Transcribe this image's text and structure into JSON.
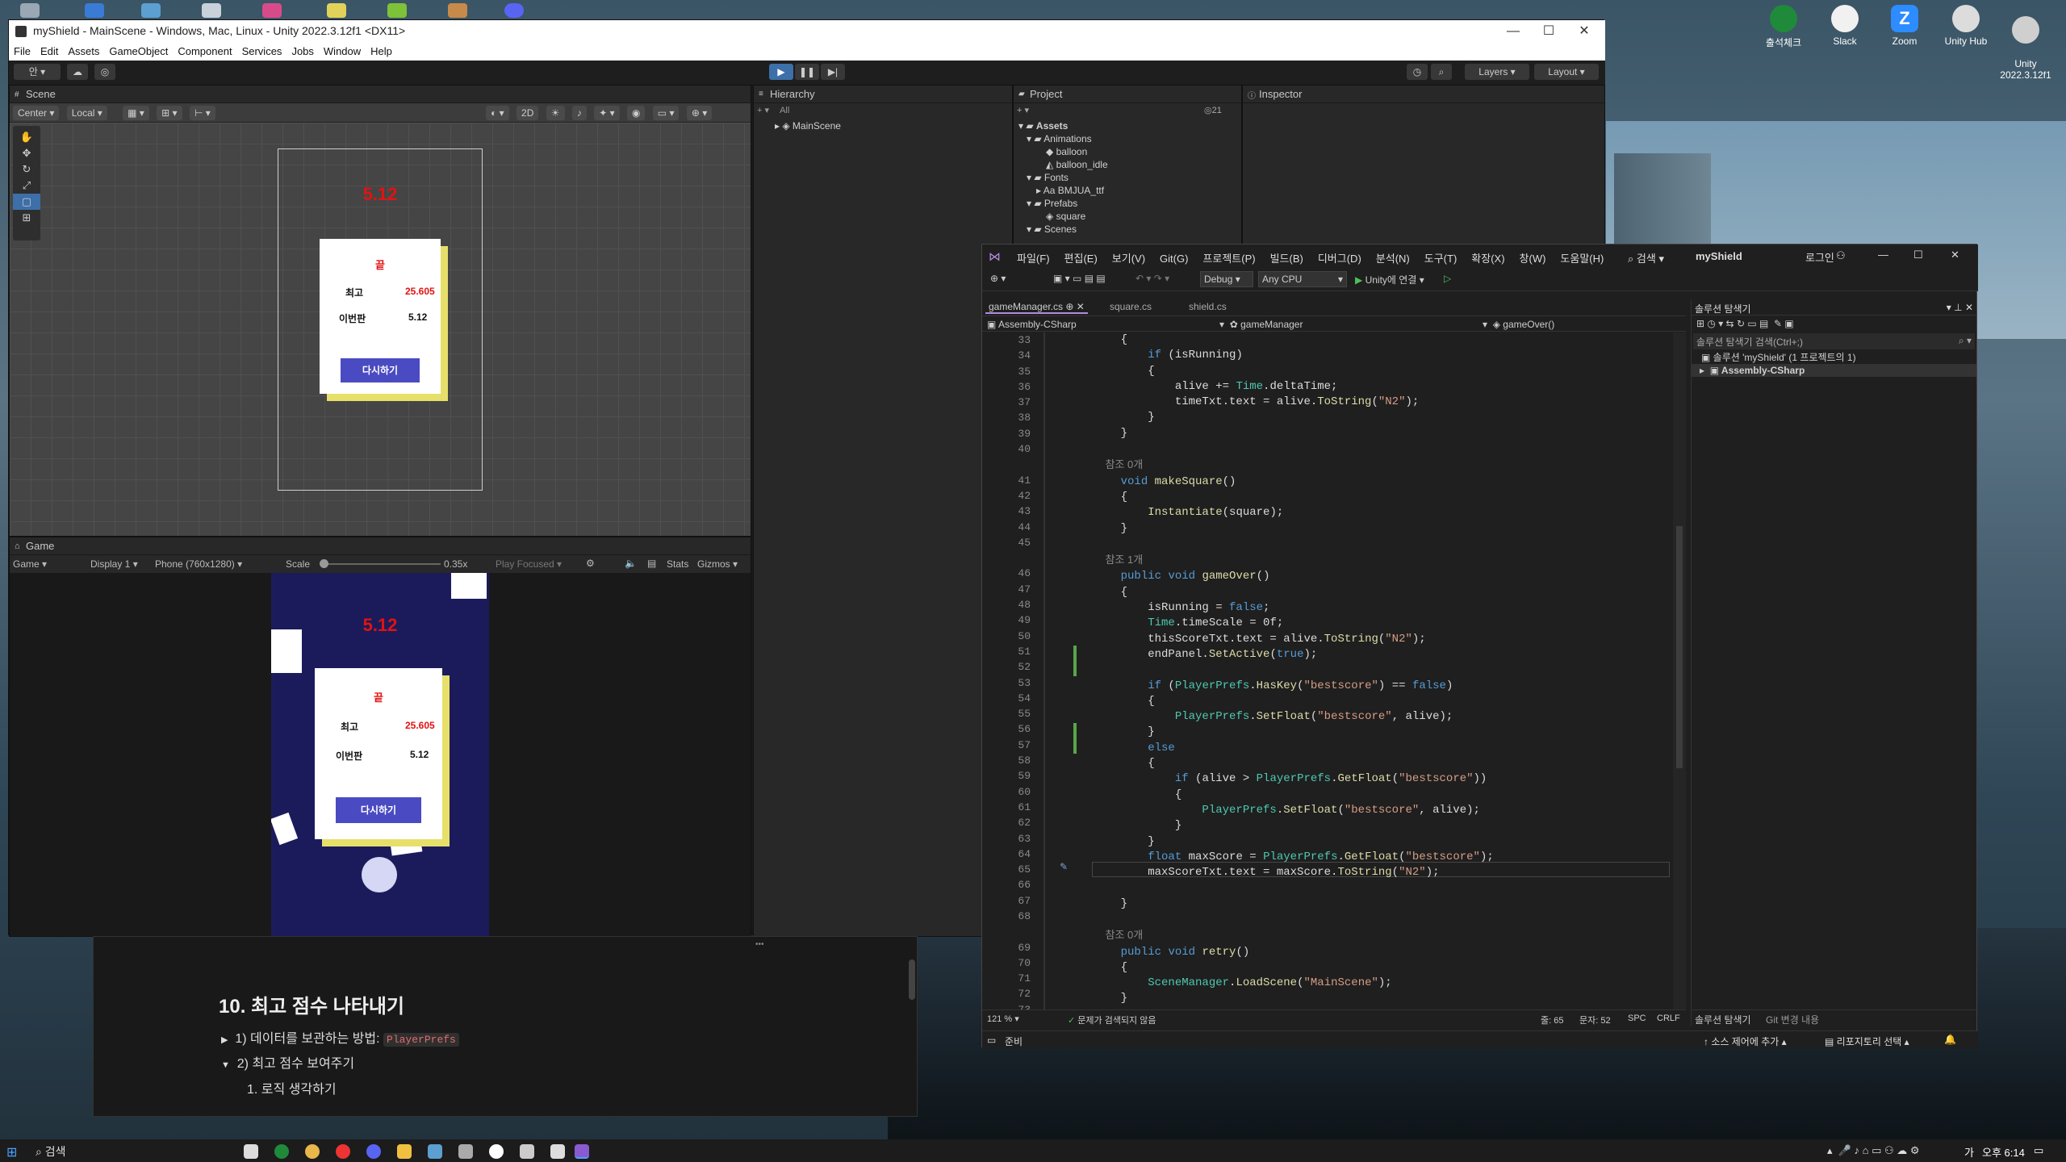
{
  "desktop": {
    "icons": [
      {
        "label": "출석체크",
        "color": "#1f8a3a"
      },
      {
        "label": "Slack",
        "color": "#e8e8e8"
      },
      {
        "label": "Zoom",
        "color": "#2d8cff"
      },
      {
        "label": "Unity Hub",
        "color": "#dddddd"
      },
      {
        "label": "Unity\n2022.3.12f1",
        "color": "#cccccc"
      }
    ]
  },
  "unity": {
    "title": "myShield - MainScene - Windows, Mac, Linux - Unity 2022.3.12f1 <DX11>",
    "menu": [
      "File",
      "Edit",
      "Assets",
      "GameObject",
      "Component",
      "Services",
      "Jobs",
      "Window",
      "Help"
    ],
    "toolbar": {
      "account": "안",
      "layers": "Layers",
      "layout": "Layout"
    },
    "scene": {
      "tab": "Scene",
      "pivot": "Center",
      "space": "Local",
      "mode2d": "2D",
      "score": "5.12",
      "card_title": "끝",
      "best_label": "최고",
      "best_value": "25.605",
      "this_label": "이번판",
      "this_value": "5.12",
      "retry": "다시하기"
    },
    "game": {
      "tab": "Game",
      "view": "Game",
      "display": "Display 1",
      "resolution": "Phone (760x1280)",
      "scale_label": "Scale",
      "scale_value": "0.35x",
      "play_mode": "Play Focused",
      "stats": "Stats",
      "gizmos": "Gizmos",
      "score": "5.12",
      "card_title": "끝",
      "best_label": "최고",
      "best_value": "25.605",
      "this_label": "이번판",
      "this_value": "5.12",
      "retry": "다시하기"
    },
    "hierarchy": {
      "tab": "Hierarchy",
      "search": "All",
      "root": "MainScene"
    },
    "project": {
      "tab": "Project",
      "count": "21",
      "items": [
        "Assets",
        "Animations",
        "balloon",
        "balloon_idle",
        "Fonts",
        "BMJUA_ttf",
        "Prefabs",
        "square",
        "Scenes"
      ]
    },
    "inspector": {
      "tab": "Inspector"
    }
  },
  "vs": {
    "menu": [
      "파일(F)",
      "편집(E)",
      "보기(V)",
      "Git(G)",
      "프로젝트(P)",
      "빌드(B)",
      "디버그(D)",
      "분석(N)",
      "도구(T)",
      "확장(X)",
      "창(W)",
      "도움말(H)"
    ],
    "search": "검색",
    "project_name": "myShield",
    "login": "로그인",
    "config": "Debug",
    "platform": "Any CPU",
    "attach": "Unity에 연결",
    "tabs": [
      "gameManager.cs",
      "square.cs",
      "shield.cs"
    ],
    "nav": {
      "project": "Assembly-CSharp",
      "class": "gameManager",
      "member": "gameOver()"
    },
    "line_numbers": [
      "33",
      "34",
      "35",
      "36",
      "37",
      "38",
      "39",
      "40",
      "",
      "41",
      "42",
      "43",
      "44",
      "45",
      "",
      "46",
      "47",
      "48",
      "49",
      "50",
      "51",
      "52",
      "53",
      "54",
      "55",
      "56",
      "57",
      "58",
      "59",
      "60",
      "61",
      "62",
      "63",
      "64",
      "65",
      "66",
      "67",
      "68",
      "",
      "69",
      "70",
      "71",
      "72",
      "73"
    ],
    "code": [
      "    {",
      "        if (isRunning)",
      "        {",
      "            alive += Time.deltaTime;",
      "            timeTxt.text = alive.ToString(\"N2\");",
      "        }",
      "    }",
      "",
      "    참조 0개",
      "    void makeSquare()",
      "    {",
      "        Instantiate(square);",
      "    }",
      "",
      "    참조 1개",
      "    public void gameOver()",
      "    {",
      "        isRunning = false;",
      "        Time.timeScale = 0f;",
      "        thisScoreTxt.text = alive.ToString(\"N2\");",
      "        endPanel.SetActive(true);",
      "",
      "        if (PlayerPrefs.HasKey(\"bestscore\") == false)",
      "        {",
      "            PlayerPrefs.SetFloat(\"bestscore\", alive);",
      "        }",
      "        else",
      "        {",
      "            if (alive > PlayerPrefs.GetFloat(\"bestscore\"))",
      "            {",
      "                PlayerPrefs.SetFloat(\"bestscore\", alive);",
      "            }",
      "        }",
      "        float maxScore = PlayerPrefs.GetFloat(\"bestscore\");",
      "        maxScoreTxt.text = maxScore.ToString(\"N2\");",
      "",
      "    }",
      "",
      "    참조 0개",
      "    public void retry()",
      "    {",
      "        SceneManager.LoadScene(\"MainScene\");",
      "    }",
      ""
    ],
    "status": {
      "zoom": "121 %",
      "issues": "문제가 검색되지 않음",
      "line": "줄: 65",
      "col": "문자: 52",
      "spc": "SPC",
      "eol": "CRLF",
      "ready": "준비",
      "source_control": "소스 제어에 추가",
      "repo": "리포지토리 선택"
    },
    "solution": {
      "title": "솔루션 탐색기",
      "search": "솔루션 탐색기 검색(Ctrl+;)",
      "root": "솔루션 'myShield' (1 프로젝트의 1)",
      "project": "Assembly-CSharp",
      "tab1": "솔루션 탐색기",
      "tab2": "Git 변경 내용"
    }
  },
  "notion": {
    "heading": "10. 최고 점수 나타내기",
    "item1": "1) 데이터를 보관하는 방법:",
    "item1_code": "PlayerPrefs",
    "item2": "2) 최고 점수 보여주기",
    "item3": "1. 로직 생각하기"
  },
  "taskbar": {
    "search": "검색",
    "time": "오후 6:14",
    "lang": "가"
  }
}
